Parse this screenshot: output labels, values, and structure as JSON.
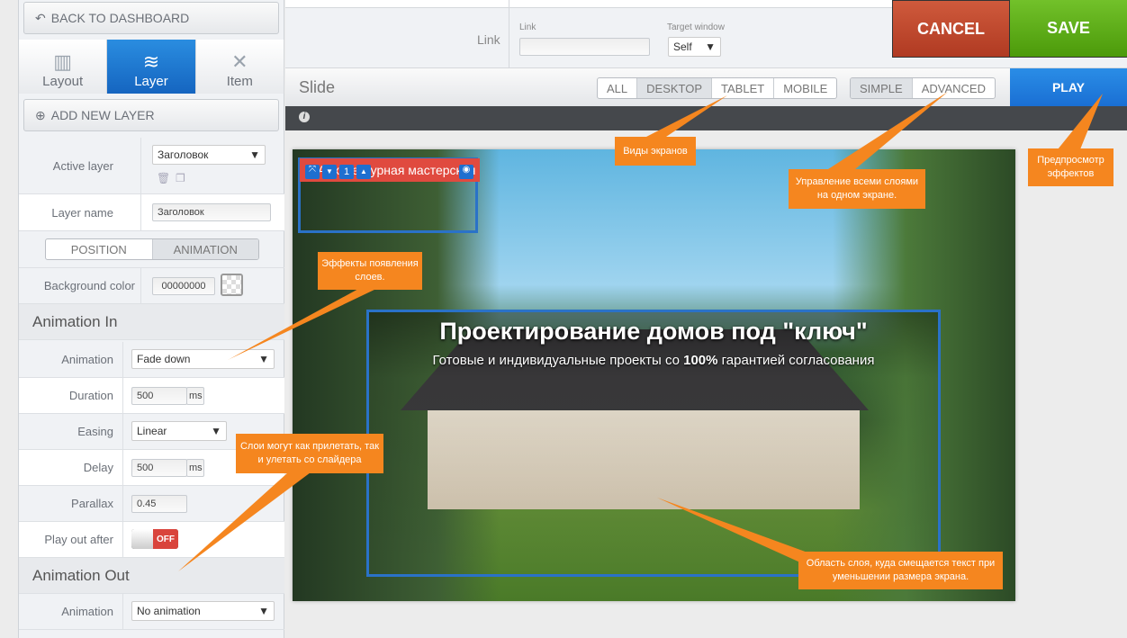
{
  "sidebar": {
    "back": "BACK TO DASHBOARD",
    "tabs": [
      {
        "label": "Layout",
        "icon": "layout-icon"
      },
      {
        "label": "Layer",
        "icon": "layers-icon"
      },
      {
        "label": "Item",
        "icon": "tools-icon"
      }
    ],
    "active_tab": "Layer",
    "add_layer": "ADD NEW LAYER",
    "active_layer_label": "Active layer",
    "active_layer_value": "Заголовок",
    "layer_name_label": "Layer name",
    "layer_name_value": "Заголовок",
    "subtabs": [
      "POSITION",
      "ANIMATION"
    ],
    "active_subtab": "ANIMATION",
    "bg_color_label": "Background color",
    "bg_color_value": "00000000",
    "anim_in": {
      "title": "Animation In",
      "animation_label": "Animation",
      "animation_value": "Fade down",
      "duration_label": "Duration",
      "duration_value": "500",
      "duration_unit": "ms",
      "easing_label": "Easing",
      "easing_value": "Linear",
      "delay_label": "Delay",
      "delay_value": "500",
      "delay_unit": "ms",
      "parallax_label": "Parallax",
      "parallax_value": "0.45",
      "playout_label": "Play out after",
      "playout_value": "OFF"
    },
    "anim_out": {
      "title": "Animation Out",
      "animation_label": "Animation",
      "animation_value": "No animation"
    }
  },
  "top": {
    "link_section": "Link",
    "link_label": "Link",
    "link_value": "",
    "target_label": "Target window",
    "target_value": "Self",
    "cancel": "CANCEL",
    "save": "SAVE",
    "cancel_color": "#c0392b",
    "save_color": "#5aab14"
  },
  "slidebar": {
    "title": "Slide",
    "devices": [
      "ALL",
      "DESKTOP",
      "TABLET",
      "MOBILE"
    ],
    "active_device": "DESKTOP",
    "modes": [
      "SIMPLE",
      "ADVANCED"
    ],
    "active_mode": "SIMPLE",
    "play": "PLAY",
    "play_color": "#1e7ee0"
  },
  "canvas": {
    "small_layer_text": "Архитектурная мастерская",
    "layer_index": "1",
    "headline": "Проектирование домов под \"ключ\"",
    "subline_pre": "Готовые и индивидуальные проекты со ",
    "subline_bold": "100%",
    "subline_post": " гарантией согласования"
  },
  "callouts": {
    "color": "#f5861f",
    "screens": "Виды экранов",
    "all_layers": "Управление всеми слоями на одном экране.",
    "preview": "Предпросмотр эффектов",
    "effects": "Эффекты появления слоев.",
    "fly": "Слои могут как прилетать, так и улетать со слайдера",
    "area": "Область слоя,  куда смещается текст при уменьшении размера экрана."
  }
}
